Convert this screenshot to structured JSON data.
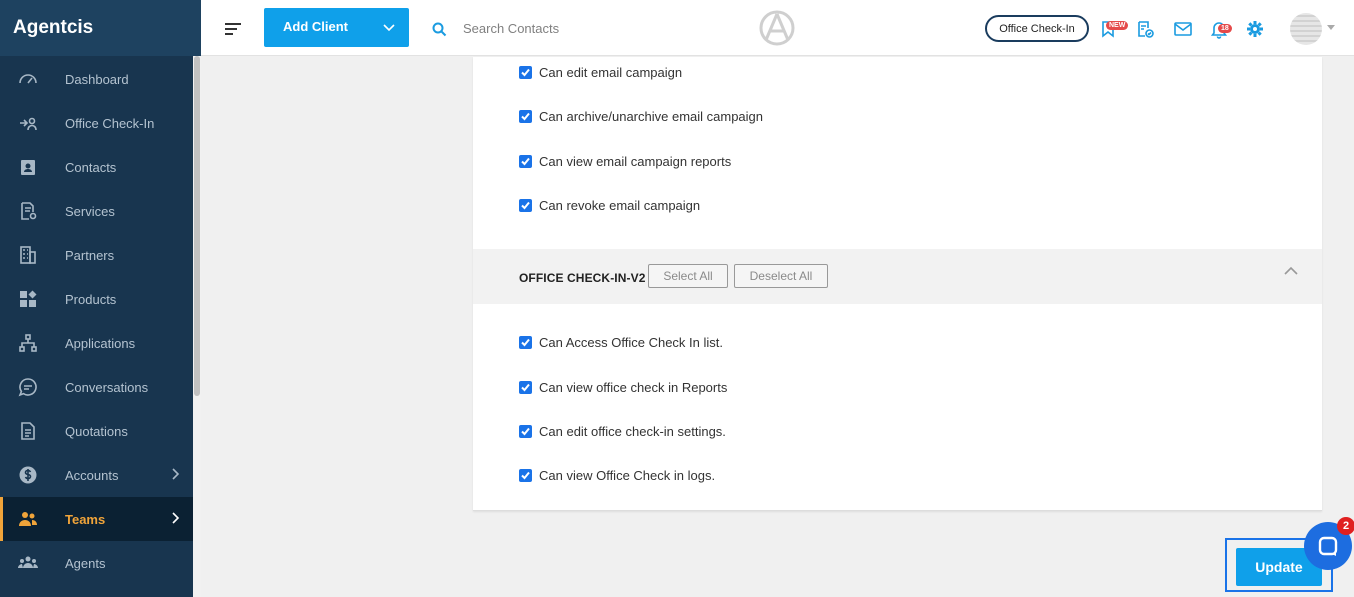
{
  "brand": "Agentcis",
  "sidebar": {
    "items": [
      {
        "label": "Dashboard",
        "icon": "gauge-icon"
      },
      {
        "label": "Office Check-In",
        "icon": "check-in-icon"
      },
      {
        "label": "Contacts",
        "icon": "contact-card-icon"
      },
      {
        "label": "Services",
        "icon": "services-icon"
      },
      {
        "label": "Partners",
        "icon": "building-icon"
      },
      {
        "label": "Products",
        "icon": "products-icon"
      },
      {
        "label": "Applications",
        "icon": "flow-icon"
      },
      {
        "label": "Conversations",
        "icon": "chat-icon"
      },
      {
        "label": "Quotations",
        "icon": "document-icon"
      },
      {
        "label": "Accounts",
        "icon": "dollar-icon"
      },
      {
        "label": "Teams",
        "icon": "team-icon"
      },
      {
        "label": "Agents",
        "icon": "agents-icon"
      }
    ]
  },
  "topbar": {
    "add_client": "Add Client",
    "search_placeholder": "Search Contacts",
    "office_checkin": "Office Check-In",
    "new_badge": "NEW",
    "notification_count": "18"
  },
  "permissions": {
    "email_campaign": [
      "Can edit email campaign",
      "Can archive/unarchive email campaign",
      "Can view email campaign reports",
      "Can revoke email campaign"
    ],
    "office_checkin_section": {
      "title": "OFFICE CHECK-IN-V2",
      "select_all": "Select All",
      "deselect_all": "Deselect All",
      "items": [
        "Can Access Office Check In list.",
        "Can view office check in Reports",
        "Can edit office check-in settings.",
        "Can view Office Check in logs."
      ]
    }
  },
  "actions": {
    "update": "Update",
    "chat_badge": "2"
  },
  "colors": {
    "sidebar": "#18354f",
    "accent": "#0fa0ea",
    "active": "#f0a43a"
  }
}
